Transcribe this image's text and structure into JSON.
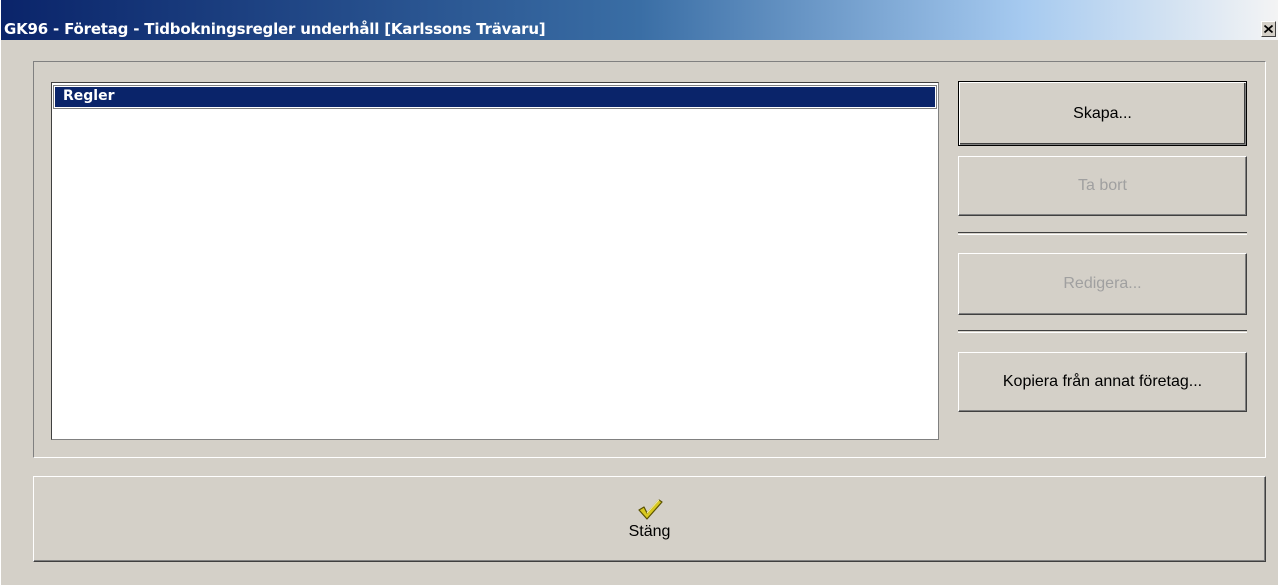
{
  "window": {
    "title": "GK96 - Företag - Tidbokningsregler underhåll [Karlssons Trävaru]",
    "close_icon": "close-icon"
  },
  "list": {
    "column_header": "Regler",
    "items": []
  },
  "actions": {
    "create_label": "Skapa...",
    "delete_label": "Ta bort",
    "edit_label": "Redigera...",
    "copy_label": "Kopiera från annat företag..."
  },
  "footer": {
    "close_label": "Stäng",
    "close_icon": "checkmark-icon"
  },
  "colors": {
    "title_gradient_start": "#0a246a",
    "list_header_bg": "#0a246a",
    "dialog_bg": "#d4d0c8",
    "disabled_text": "#a0a0a0",
    "checkmark": "#d8c820"
  }
}
